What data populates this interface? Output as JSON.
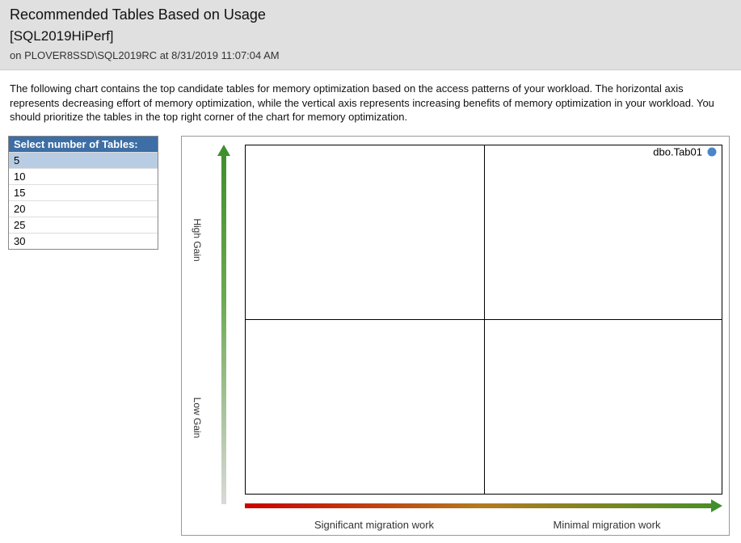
{
  "header": {
    "title": "Recommended Tables Based on Usage",
    "database": "[SQL2019HiPerf]",
    "meta": "on PLOVER8SSD\\SQL2019RC at 8/31/2019 11:07:04 AM"
  },
  "description": "The following chart contains the top candidate tables for memory optimization based on the access patterns of your workload. The horizontal axis represents decreasing effort of memory optimization, while the vertical axis represents increasing benefits of memory optimization in your workload. You should prioritize the tables in the top right corner of the chart for memory optimization.",
  "selector": {
    "header": "Select number of Tables:",
    "options": [
      "5",
      "10",
      "15",
      "20",
      "25",
      "30"
    ],
    "selected": "5"
  },
  "axes": {
    "y_high": "High Gain",
    "y_low": "Low Gain",
    "x_left": "Significant migration work",
    "x_right": "Minimal migration work"
  },
  "chart_data": {
    "type": "scatter",
    "title": "Recommended Tables Based on Usage",
    "xlabel": "Migration work (left = significant, right = minimal)",
    "ylabel": "Gain (bottom = low, top = high)",
    "xlim": [
      0,
      1
    ],
    "ylim": [
      0,
      1
    ],
    "series": [
      {
        "name": "dbo.Tab01",
        "x": [
          0.98
        ],
        "y": [
          0.98
        ]
      }
    ]
  }
}
